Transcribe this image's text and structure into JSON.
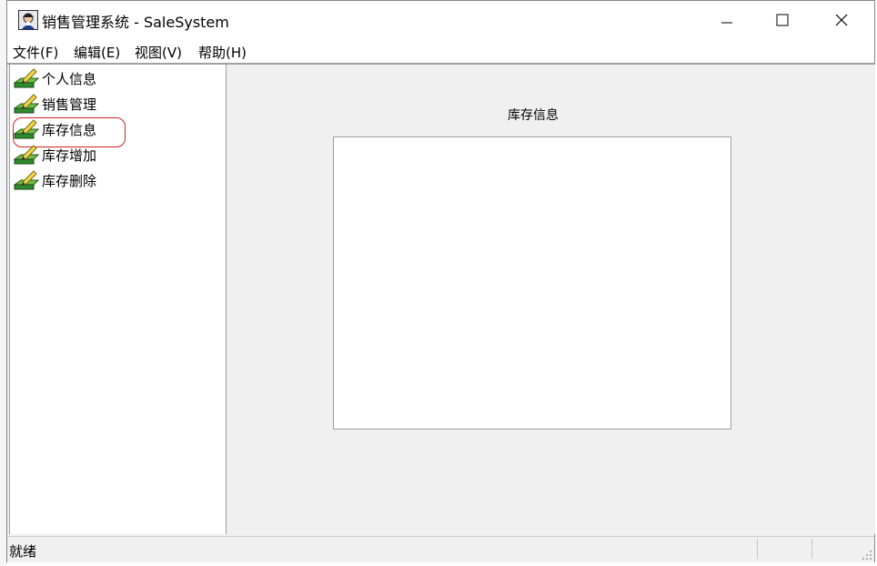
{
  "window": {
    "title": "销售管理系统 - SaleSystem"
  },
  "menu": {
    "items": [
      "文件(F)",
      "编辑(E)",
      "视图(V)",
      "帮助(H)"
    ]
  },
  "tree": {
    "items": [
      {
        "label": "个人信息",
        "icon": "edit-tray-icon"
      },
      {
        "label": "销售管理",
        "icon": "edit-tray-icon"
      },
      {
        "label": "库存信息",
        "icon": "edit-tray-icon",
        "highlighted": true
      },
      {
        "label": "库存增加",
        "icon": "edit-tray-icon"
      },
      {
        "label": "库存删除",
        "icon": "edit-tray-icon"
      }
    ]
  },
  "content": {
    "title": "库存信息"
  },
  "status": {
    "text": "就绪"
  },
  "colors": {
    "highlight": "#d0202a",
    "tray_green": "#2e8b2e"
  }
}
